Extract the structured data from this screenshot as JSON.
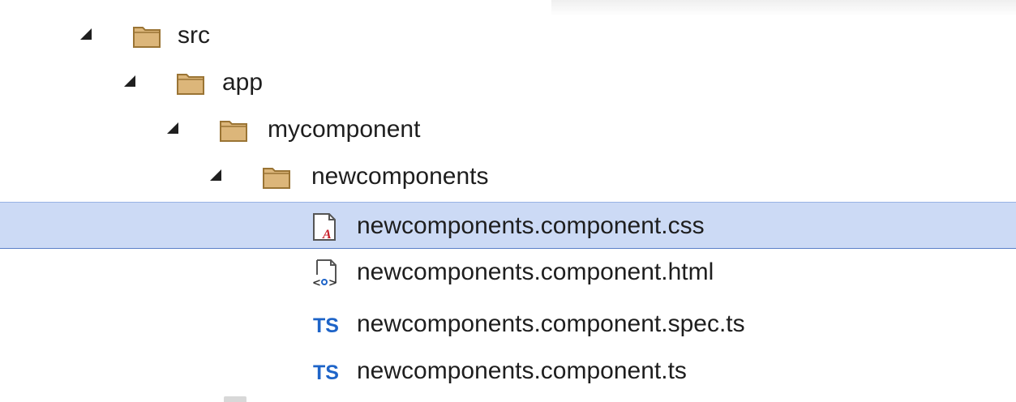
{
  "tree": {
    "nodes": [
      {
        "label": "src",
        "kind": "folder",
        "expanded": true,
        "depth": 0,
        "icon": "folder-icon"
      },
      {
        "label": "app",
        "kind": "folder",
        "expanded": true,
        "depth": 1,
        "icon": "folder-icon"
      },
      {
        "label": "mycomponent",
        "kind": "folder",
        "expanded": true,
        "depth": 2,
        "icon": "folder-icon"
      },
      {
        "label": "newcomponents",
        "kind": "folder",
        "expanded": true,
        "depth": 3,
        "icon": "folder-icon"
      },
      {
        "label": "newcomponents.component.css",
        "kind": "file",
        "selected": true,
        "depth": 4,
        "icon": "css-file-icon"
      },
      {
        "label": "newcomponents.component.html",
        "kind": "file",
        "depth": 4,
        "icon": "html-file-icon"
      },
      {
        "label": "newcomponents.component.spec.ts",
        "kind": "file",
        "depth": 4,
        "icon": "typescript-file-icon",
        "icon_text": "TS"
      },
      {
        "label": "newcomponents.component.ts",
        "kind": "file",
        "depth": 4,
        "icon": "typescript-file-icon",
        "icon_text": "TS"
      }
    ]
  },
  "colors": {
    "selection_background": "#ccdaf5",
    "selection_border": "#5a7fc7",
    "folder_fill": "#dcb67a",
    "folder_stroke": "#9a7434",
    "typescript_blue": "#1e64c8",
    "css_red": "#c8202a"
  }
}
